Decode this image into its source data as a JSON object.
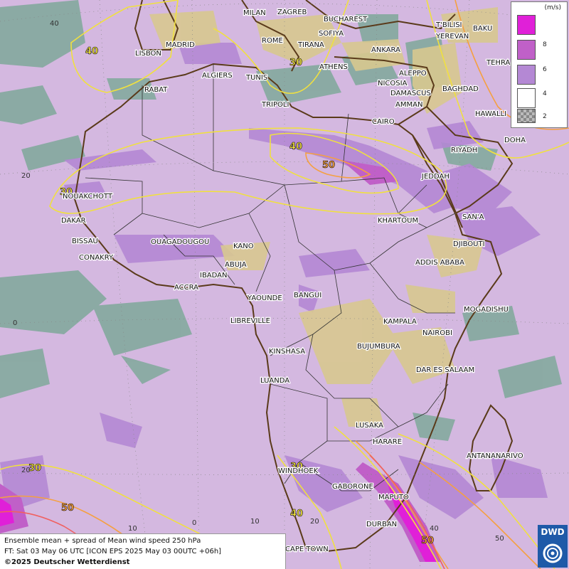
{
  "cities": [
    {
      "name": "MILAN"
    },
    {
      "name": "ZAGREB"
    },
    {
      "name": "BUCHAREST"
    },
    {
      "name": "T'BILISI"
    },
    {
      "name": "BAKU"
    },
    {
      "name": "SOFIYA"
    },
    {
      "name": "YEREVAN"
    },
    {
      "name": "MADRID"
    },
    {
      "name": "ROME"
    },
    {
      "name": "TIRANA"
    },
    {
      "name": "ANKARA"
    },
    {
      "name": "TEHRA"
    },
    {
      "name": "LISBON"
    },
    {
      "name": "ATHENS"
    },
    {
      "name": "ALGIERS"
    },
    {
      "name": "TUNIS"
    },
    {
      "name": "ALEPPO"
    },
    {
      "name": "NICOSIA"
    },
    {
      "name": "BAGHDAD"
    },
    {
      "name": "RABAT"
    },
    {
      "name": "DAMASCUS"
    },
    {
      "name": "TRIPOLI"
    },
    {
      "name": "AMMAN"
    },
    {
      "name": "HAWALLI"
    },
    {
      "name": "CAIRO"
    },
    {
      "name": "DOHA"
    },
    {
      "name": "RIYADH"
    },
    {
      "name": "JEDDAH"
    },
    {
      "name": "NOUAKCHOTT"
    },
    {
      "name": "KHARTOUM"
    },
    {
      "name": "SAN'A"
    },
    {
      "name": "DAKAR"
    },
    {
      "name": "BISSAU"
    },
    {
      "name": "OUAGADOUGOU"
    },
    {
      "name": "DJIBOUTI"
    },
    {
      "name": "KANO"
    },
    {
      "name": "CONAKRY"
    },
    {
      "name": "ABUJA"
    },
    {
      "name": "ADDIS ABABA"
    },
    {
      "name": "IBADAN"
    },
    {
      "name": "ACCRA"
    },
    {
      "name": "YAOUNDE"
    },
    {
      "name": "BANGUI"
    },
    {
      "name": "MOGADISHU"
    },
    {
      "name": "LIBREVILLE"
    },
    {
      "name": "KAMPALA"
    },
    {
      "name": "NAIROBI"
    },
    {
      "name": "KINSHASA"
    },
    {
      "name": "BUJUMBURA"
    },
    {
      "name": "DAR ES SALAAM"
    },
    {
      "name": "LUANDA"
    },
    {
      "name": "LUSAKA"
    },
    {
      "name": "HARARE"
    },
    {
      "name": "ANTANANARIVO"
    },
    {
      "name": "WINDHOEK"
    },
    {
      "name": "GABORONE"
    },
    {
      "name": "MAPUTO"
    },
    {
      "name": "DURBAN"
    },
    {
      "name": "CAPE TOWN"
    }
  ],
  "grid_labels": [
    {
      "text": "40"
    },
    {
      "text": "20"
    },
    {
      "text": "0"
    },
    {
      "text": "20"
    },
    {
      "text": "10"
    },
    {
      "text": "0"
    },
    {
      "text": "10"
    },
    {
      "text": "20"
    },
    {
      "text": "40"
    },
    {
      "text": "50"
    }
  ],
  "contour_labels": [
    {
      "value": "40",
      "color": "#f0e040"
    },
    {
      "value": "30",
      "color": "#f0e040"
    },
    {
      "value": "40",
      "color": "#f0e040"
    },
    {
      "value": "50",
      "color": "#f5a040"
    },
    {
      "value": "30",
      "color": "#f0e040"
    },
    {
      "value": "30",
      "color": "#f0e040"
    },
    {
      "value": "50",
      "color": "#f5a040"
    },
    {
      "value": "30",
      "color": "#f0e040"
    },
    {
      "value": "40",
      "color": "#f0e040"
    },
    {
      "value": "50",
      "color": "#f5a040"
    }
  ],
  "legend": {
    "unit": "(m/s)",
    "items": [
      {
        "label": "8",
        "color": "#e020d8"
      },
      {
        "label": "6",
        "color": "#c060c8"
      },
      {
        "label": "4",
        "color": "#b488d4"
      },
      {
        "label": "2",
        "color": "#d4b8e0"
      }
    ]
  },
  "caption": {
    "line1": "Ensemble mean + spread of Mean wind speed 250 hPa",
    "line2": "FT: Sat 03 May 06 UTC [ICON EPS 2025 May 03 00UTC +06h]",
    "line3": "©2025 Deutscher Wetterdienst"
  },
  "logo": {
    "text": "DWD"
  },
  "colors": {
    "background": "#d4b8e0",
    "sea_patches": "#7fa89a",
    "land_patches": "#d8c890",
    "contour_yellow": "#f0e040",
    "contour_orange": "#f5a040",
    "contour_red": "#f06060"
  }
}
